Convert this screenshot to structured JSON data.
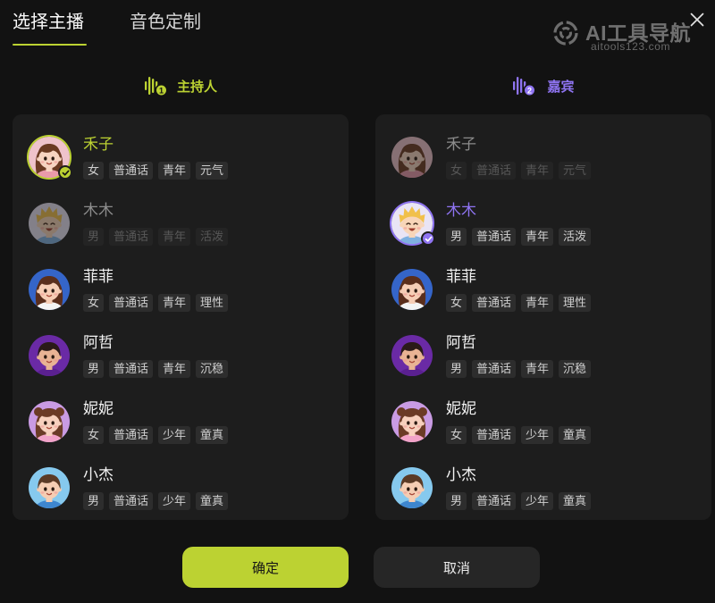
{
  "tabs": [
    {
      "label": "选择主播",
      "active": true
    },
    {
      "label": "音色定制",
      "active": false
    }
  ],
  "watermark": {
    "icon": "watermark-logo-icon",
    "brand": "AI工具导航",
    "url": "aitools123.com"
  },
  "close": {
    "icon": "close-icon"
  },
  "colors": {
    "background": "#121212",
    "panel": "#1d1d1d",
    "accent_green": "#bcd232",
    "accent_purple": "#8f74f2",
    "tag_background": "#2d2d2d",
    "cancel_button": "#262626"
  },
  "host_panel": {
    "icon": "sound-wave-icon",
    "badge": "1",
    "title": "主持人",
    "selection_icon": "check-icon",
    "voices": [
      {
        "name": "禾子",
        "tags": [
          "女",
          "普通话",
          "青年",
          "元气"
        ],
        "selected": true,
        "disabled": false
      },
      {
        "name": "木木",
        "tags": [
          "男",
          "普通话",
          "青年",
          "活泼"
        ],
        "selected": false,
        "disabled": true
      },
      {
        "name": "菲菲",
        "tags": [
          "女",
          "普通话",
          "青年",
          "理性"
        ],
        "selected": false,
        "disabled": false
      },
      {
        "name": "阿哲",
        "tags": [
          "男",
          "普通话",
          "青年",
          "沉稳"
        ],
        "selected": false,
        "disabled": false
      },
      {
        "name": "妮妮",
        "tags": [
          "女",
          "普通话",
          "少年",
          "童真"
        ],
        "selected": false,
        "disabled": false
      },
      {
        "name": "小杰",
        "tags": [
          "男",
          "普通话",
          "少年",
          "童真"
        ],
        "selected": false,
        "disabled": false
      }
    ]
  },
  "guest_panel": {
    "icon": "sound-wave-icon",
    "badge": "2",
    "title": "嘉宾",
    "selection_icon": "check-icon",
    "voices": [
      {
        "name": "禾子",
        "tags": [
          "女",
          "普通话",
          "青年",
          "元气"
        ],
        "selected": false,
        "disabled": true
      },
      {
        "name": "木木",
        "tags": [
          "男",
          "普通话",
          "青年",
          "活泼"
        ],
        "selected": true,
        "disabled": false
      },
      {
        "name": "菲菲",
        "tags": [
          "女",
          "普通话",
          "青年",
          "理性"
        ],
        "selected": false,
        "disabled": false
      },
      {
        "name": "阿哲",
        "tags": [
          "男",
          "普通话",
          "青年",
          "沉稳"
        ],
        "selected": false,
        "disabled": false
      },
      {
        "name": "妮妮",
        "tags": [
          "女",
          "普通话",
          "少年",
          "童真"
        ],
        "selected": false,
        "disabled": false
      },
      {
        "name": "小杰",
        "tags": [
          "男",
          "普通话",
          "少年",
          "童真"
        ],
        "selected": false,
        "disabled": false
      }
    ]
  },
  "actions": {
    "confirm": "确定",
    "cancel": "取消"
  }
}
